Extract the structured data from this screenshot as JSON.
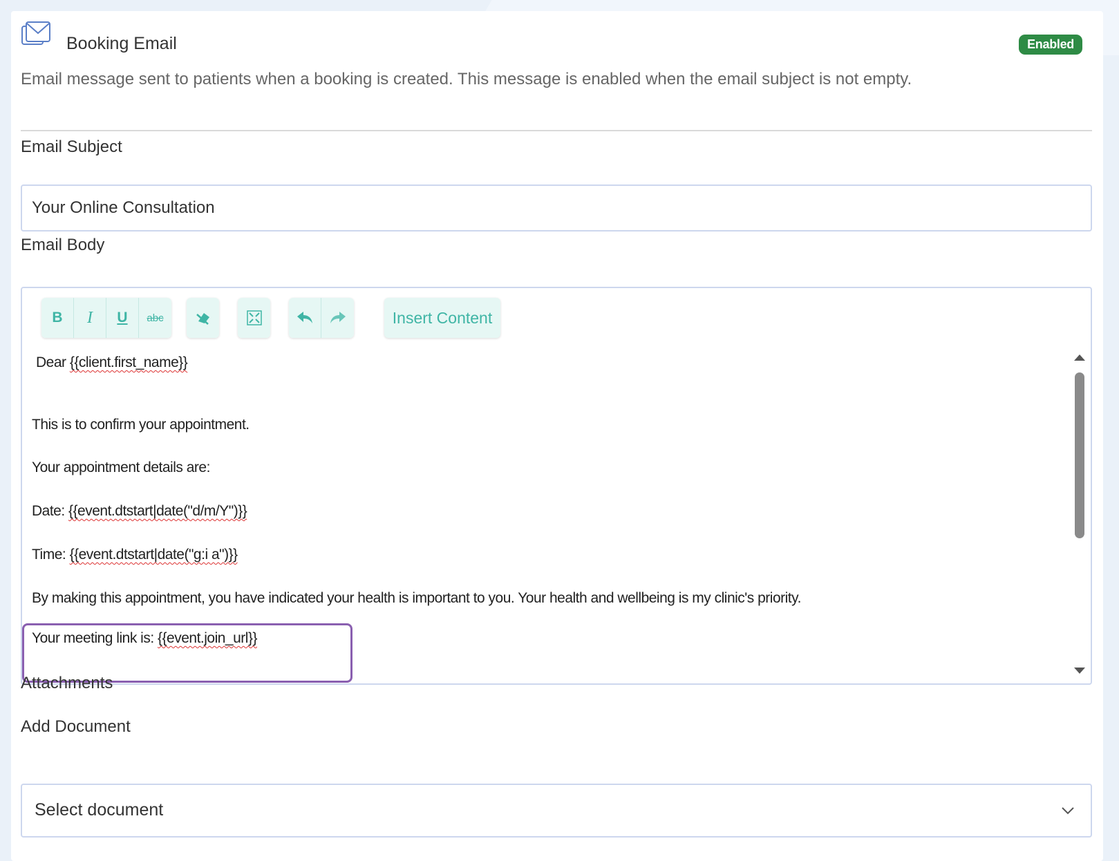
{
  "header": {
    "title": "Booking Email",
    "status_badge": "Enabled",
    "description": "Email message sent to patients when a booking is created. This message is enabled when the email subject is not empty.",
    "icon": "envelope-icon"
  },
  "subject": {
    "label": "Email Subject",
    "value": "Your Online Consultation"
  },
  "body": {
    "label": "Email Body",
    "toolbar": {
      "bold": "B",
      "italic": "I",
      "underline": "U",
      "strikethrough": "abc",
      "clear_format_icon": "eraser-icon",
      "fullscreen_icon": "fullscreen-icon",
      "undo_icon": "undo-icon",
      "redo_icon": "redo-icon",
      "insert_content": "Insert Content"
    },
    "lines": {
      "greeting_prefix": "Dear ",
      "greeting_tpl": "{{client.first_name}}",
      "confirm": "This is to confirm your appointment.",
      "details": "Your appointment details are:",
      "date_prefix": "Date: ",
      "date_tpl": "{{event.dtstart|date(\"d/m/Y\")}}",
      "time_prefix": "Time: ",
      "time_tpl": "{{event.dtstart|date(\"g:i a\")}}",
      "health": "By making this appointment, you have indicated your health is important to you.  Your health and wellbeing is my clinic's priority.",
      "link_prefix": "Your meeting link is: ",
      "link_tpl": "{{event.join_url}}"
    }
  },
  "attachments": {
    "section_label": "Attachments",
    "add_label": "Add Document",
    "select_value": "Select document"
  },
  "colors": {
    "badge_green": "#2e8b45",
    "toolbar_teal": "#3fb5a5",
    "highlight_purple": "#8a5fb0"
  }
}
